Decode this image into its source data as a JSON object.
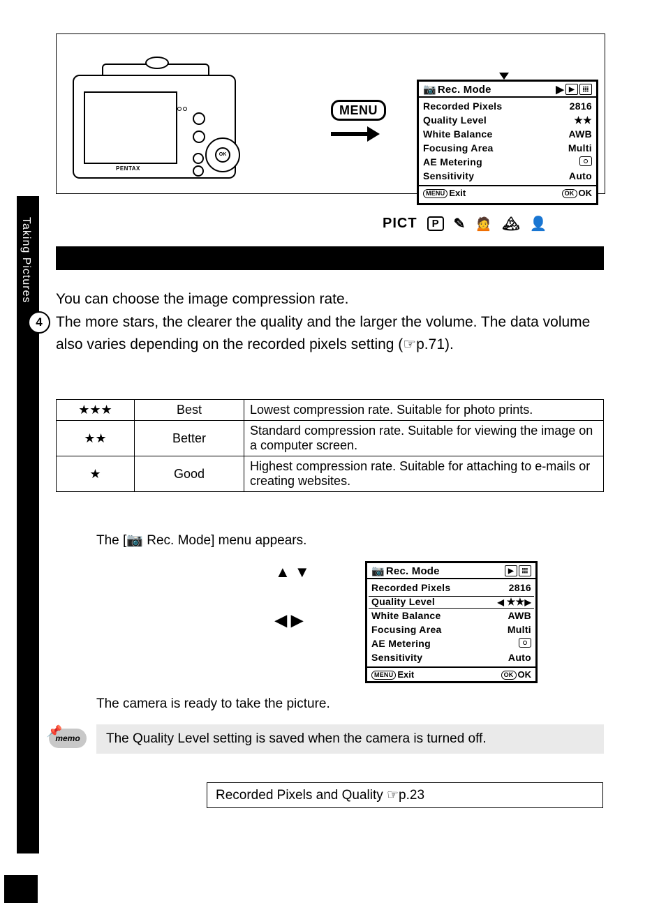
{
  "illustration": {
    "camera_brand": "PENTAX",
    "ok_center": "OK",
    "menu_label": "MENU"
  },
  "lcd1": {
    "title_text": "Rec. Mode",
    "tab_play": "▶",
    "tab_setup": "⚙",
    "rows": [
      {
        "l": "Recorded Pixels",
        "r": "2816"
      },
      {
        "l": "Quality Level",
        "r": "★★"
      },
      {
        "l": "White Balance",
        "r": "AWB"
      },
      {
        "l": "Focusing Area",
        "r": "Multi"
      },
      {
        "l": "AE Metering",
        "r": ""
      },
      {
        "l": "Sensitivity",
        "r": "Auto"
      }
    ],
    "foot_exit_btn": "MENU",
    "foot_exit": "Exit",
    "foot_ok_btn": "OK",
    "foot_ok": "OK"
  },
  "mode_strip": {
    "pict": "PICT",
    "p": "P"
  },
  "body": {
    "p1": "You can choose the image compression rate.",
    "p2": "The more stars, the clearer the quality and the larger the volume. The data volume also varies depending on the recorded pixels setting (☞p.71)."
  },
  "table": {
    "rows": [
      {
        "stars": "★★★",
        "name": "Best",
        "desc": "Lowest compression rate. Suitable for photo prints."
      },
      {
        "stars": "★★",
        "name": "Better",
        "desc": "Standard compression rate. Suitable for viewing the image on a computer screen."
      },
      {
        "stars": "★",
        "name": "Good",
        "desc": "Highest compression rate. Suitable for attaching to e-mails or creating websites."
      }
    ]
  },
  "steps": {
    "s1_text": "The [📷 Rec. Mode] menu appears.",
    "arrows_ud": "▲ ▼",
    "arrows_lr": "◀ ▶",
    "s2_text": "The camera is ready to take the picture."
  },
  "lcd2": {
    "title_text": "Rec. Mode",
    "rows": [
      {
        "l": "Recorded Pixels",
        "r": "2816"
      },
      {
        "l": "Quality Level",
        "r": "★★",
        "sel": true,
        "arrows": true
      },
      {
        "l": "White Balance",
        "r": "AWB"
      },
      {
        "l": "Focusing Area",
        "r": "Multi"
      },
      {
        "l": "AE Metering",
        "r": ""
      },
      {
        "l": "Sensitivity",
        "r": "Auto"
      }
    ],
    "foot_exit_btn": "MENU",
    "foot_exit": "Exit",
    "foot_ok_btn": "OK",
    "foot_ok": "OK"
  },
  "memo": "The Quality Level setting is saved when the camera is turned off.",
  "memo_tag": "memo",
  "link_box": "Recorded Pixels and Quality ☞p.23",
  "chapter_num": "4",
  "chapter_side": "Taking Pictures"
}
